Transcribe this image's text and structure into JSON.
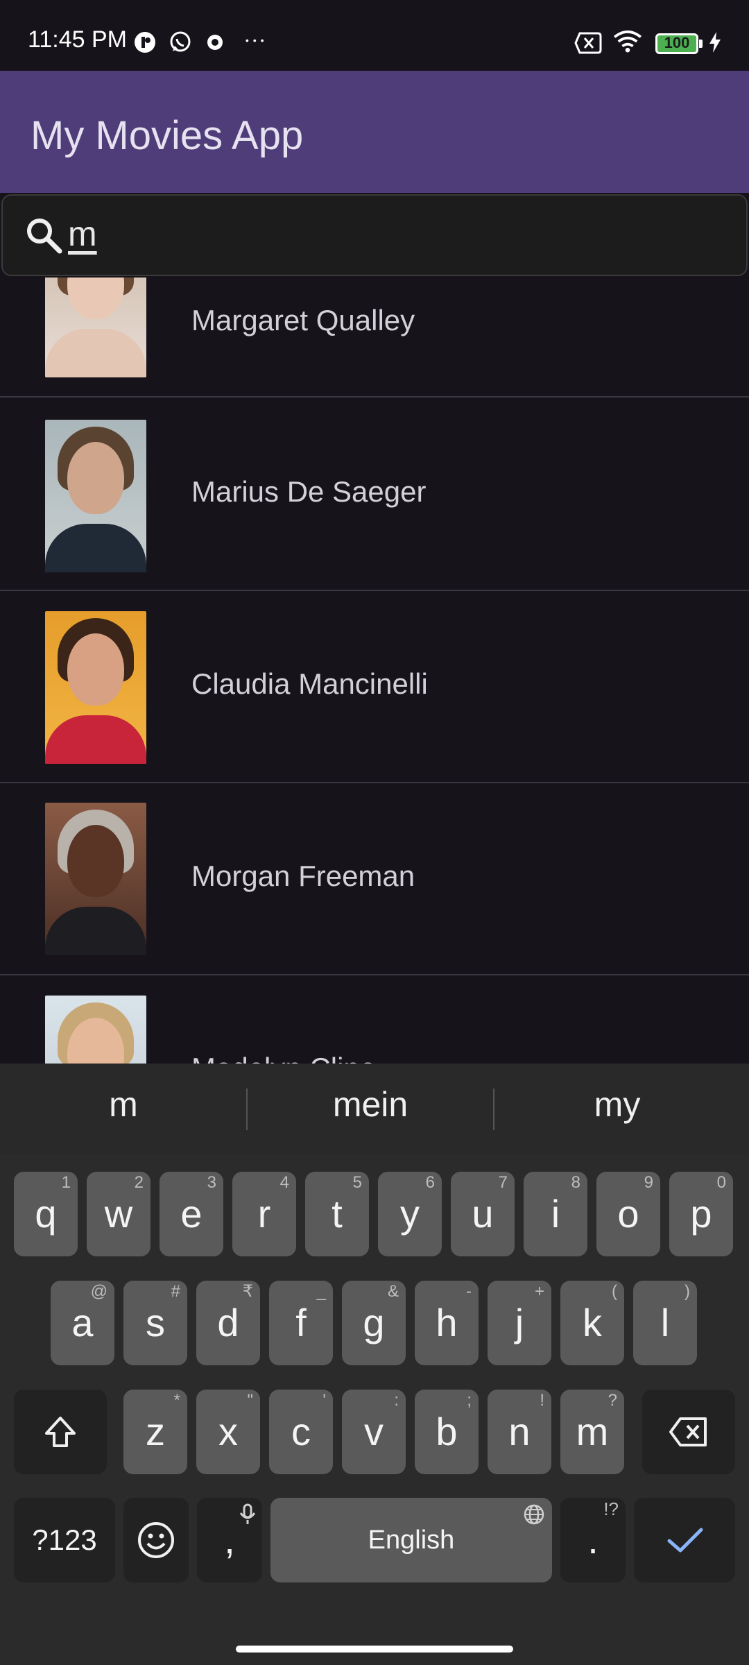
{
  "status": {
    "time": "11:45 PM",
    "battery": "100",
    "more": "···"
  },
  "app": {
    "title": "My Movies App"
  },
  "search": {
    "value": "m"
  },
  "people": [
    {
      "name": "Margaret Qualley"
    },
    {
      "name": "Marius De Saeger"
    },
    {
      "name": "Claudia Mancinelli"
    },
    {
      "name": "Morgan Freeman"
    },
    {
      "name": "Madelyn Cline"
    }
  ],
  "keyboard": {
    "suggestions": [
      "m",
      "mein",
      "my"
    ],
    "row1": [
      {
        "k": "q",
        "h": "1"
      },
      {
        "k": "w",
        "h": "2"
      },
      {
        "k": "e",
        "h": "3"
      },
      {
        "k": "r",
        "h": "4"
      },
      {
        "k": "t",
        "h": "5"
      },
      {
        "k": "y",
        "h": "6"
      },
      {
        "k": "u",
        "h": "7"
      },
      {
        "k": "i",
        "h": "8"
      },
      {
        "k": "o",
        "h": "9"
      },
      {
        "k": "p",
        "h": "0"
      }
    ],
    "row2": [
      {
        "k": "a",
        "h": "@"
      },
      {
        "k": "s",
        "h": "#"
      },
      {
        "k": "d",
        "h": "₹"
      },
      {
        "k": "f",
        "h": "_"
      },
      {
        "k": "g",
        "h": "&"
      },
      {
        "k": "h",
        "h": "-"
      },
      {
        "k": "j",
        "h": "+"
      },
      {
        "k": "k",
        "h": "("
      },
      {
        "k": "l",
        "h": ")"
      }
    ],
    "row3": [
      {
        "k": "z",
        "h": "*"
      },
      {
        "k": "x",
        "h": "\""
      },
      {
        "k": "c",
        "h": "'"
      },
      {
        "k": "v",
        "h": ":"
      },
      {
        "k": "b",
        "h": ";"
      },
      {
        "k": "n",
        "h": "!"
      },
      {
        "k": "m",
        "h": "?"
      }
    ],
    "symbols": "?123",
    "comma": ",",
    "space": "English",
    "period": ".",
    "period_hint": "!?"
  }
}
